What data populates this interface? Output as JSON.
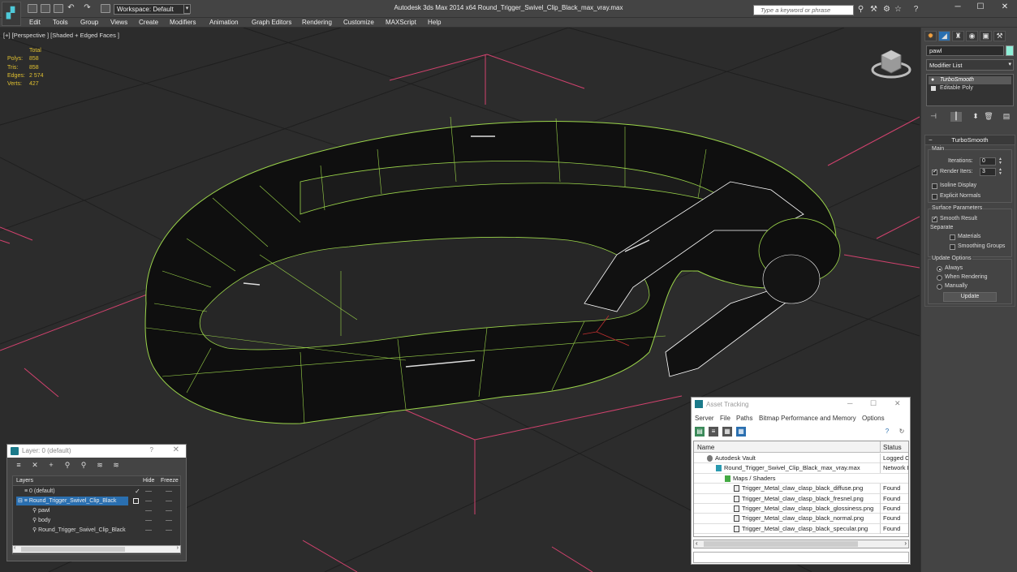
{
  "titlebar": {
    "workspace": "Workspace: Default",
    "title": "Autodesk 3ds Max  2014 x64      Round_Trigger_Swivel_Clip_Black_max_vray.max",
    "search_placeholder": "Type a keyword or phrase"
  },
  "menu": [
    "Edit",
    "Tools",
    "Group",
    "Views",
    "Create",
    "Modifiers",
    "Animation",
    "Graph Editors",
    "Rendering",
    "Customize",
    "MAXScript",
    "Help"
  ],
  "viewport": {
    "label": "[+] [Perspective ] [Shaded + Edged Faces ]",
    "stats": {
      "header": "Total",
      "rows": [
        {
          "k": "Polys:",
          "v": "858"
        },
        {
          "k": "Tris:",
          "v": "858"
        },
        {
          "k": "Edges:",
          "v": "2 574"
        },
        {
          "k": "Verts:",
          "v": "427"
        }
      ]
    }
  },
  "command_panel": {
    "object_name": "pawl",
    "modifier_list": "Modifier List",
    "stack": [
      "TurboSmooth",
      "Editable Poly"
    ],
    "rollout_title": "TurboSmooth",
    "main_group": "Main",
    "iterations_label": "Iterations:",
    "iterations_value": "0",
    "render_iters_label": "Render Iters:",
    "render_iters_value": "3",
    "isoline_label": "Isoline Display",
    "explicit_normals_label": "Explicit Normals",
    "surface_params_group": "Surface Parameters",
    "smooth_result_label": "Smooth Result",
    "separate_label": "Separate",
    "materials_label": "Materials",
    "smoothing_groups_label": "Smoothing Groups",
    "update_options_group": "Update Options",
    "always_label": "Always",
    "when_rendering_label": "When Rendering",
    "manually_label": "Manually",
    "update_button": "Update"
  },
  "layer_window": {
    "title": "Layer: 0 (default)",
    "help": "?",
    "close": "✕",
    "columns": {
      "layers": "Layers",
      "hide": "Hide",
      "freeze": "Freeze"
    },
    "rows": [
      "0 (default)",
      "Round_Trigger_Swivel_Clip_Black",
      "pawl",
      "body",
      "Round_Trigger_Swivel_Clip_Black"
    ]
  },
  "asset_window": {
    "title": "Asset Tracking",
    "menu": [
      "Server",
      "File",
      "Paths",
      "Bitmap Performance and Memory",
      "Options"
    ],
    "columns": {
      "name": "Name",
      "status": "Status"
    },
    "rows": [
      {
        "name": "Autodesk Vault",
        "status": "Logged O"
      },
      {
        "name": "Round_Trigger_Swivel_Clip_Black_max_vray.max",
        "status": "Network P"
      },
      {
        "name": "Maps / Shaders",
        "status": ""
      },
      {
        "name": "Trigger_Metal_claw_clasp_black_diffuse.png",
        "status": "Found"
      },
      {
        "name": "Trigger_Metal_claw_clasp_black_fresnel.png",
        "status": "Found"
      },
      {
        "name": "Trigger_Metal_claw_clasp_black_glossiness.png",
        "status": "Found"
      },
      {
        "name": "Trigger_Metal_claw_clasp_black_normal.png",
        "status": "Found"
      },
      {
        "name": "Trigger_Metal_claw_clasp_black_specular.png",
        "status": "Found"
      }
    ]
  },
  "colors": {
    "wireframe": "#9bd54a",
    "grid_red": "#d2426e",
    "stats_yellow": "#e0c030",
    "selection_blue": "#2a6fb0"
  }
}
